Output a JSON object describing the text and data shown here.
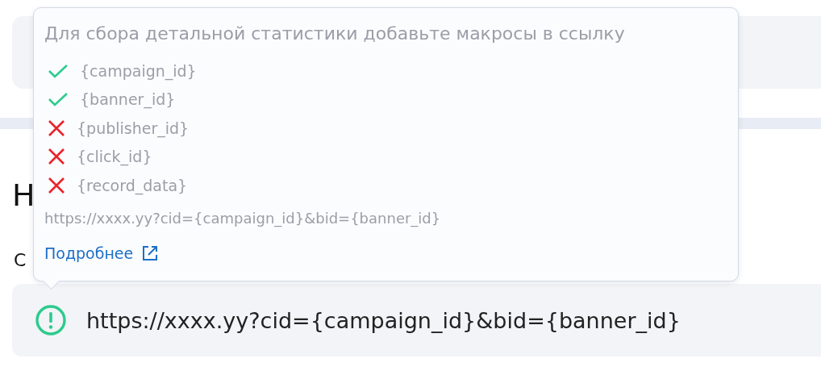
{
  "heading": "Н",
  "field": {
    "label": "С",
    "value": "https://xxxx.yy?cid={campaign_id}&bid={banner_id}"
  },
  "tooltip": {
    "title": "Для сбора детальной статистики добавьте макросы в ссылку",
    "macros": [
      {
        "name": "{campaign_id}",
        "present": true
      },
      {
        "name": "{banner_id}",
        "present": true
      },
      {
        "name": "{publisher_id}",
        "present": false
      },
      {
        "name": "{click_id}",
        "present": false
      },
      {
        "name": "{record_data}",
        "present": false
      }
    ],
    "example": "https://xxxx.yy?cid={campaign_id}&bid={banner_id}",
    "link": "Подробнее"
  }
}
